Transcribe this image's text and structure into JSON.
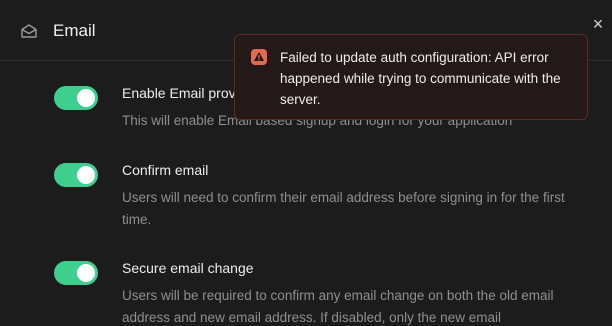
{
  "header": {
    "title": "Email",
    "icon": "envelope-icon",
    "close_icon": "close-icon",
    "close_glyph": "×"
  },
  "settings": [
    {
      "title": "Enable Email provider",
      "description": "This will enable Email based signup and login for your application",
      "enabled": true
    },
    {
      "title": "Confirm email",
      "description": "Users will need to confirm their email address before signing in for the first time.",
      "enabled": true
    },
    {
      "title": "Secure email change",
      "description": "Users will be required to confirm any email change on both the old email address and new email address. If disabled, only the new email",
      "enabled": true
    }
  ],
  "toast": {
    "message": "Failed to update auth configuration: API error happened while trying to communicate with the server.",
    "icon": "warning-icon",
    "accent_color": "#e5694d"
  },
  "colors": {
    "toggle_on": "#3ecf8e",
    "background": "#1c1c1c"
  }
}
